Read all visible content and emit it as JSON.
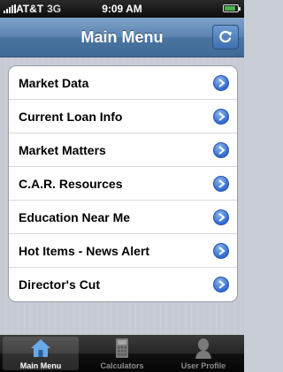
{
  "status_bar": {
    "carrier": "AT&T",
    "network": "3G",
    "time": "9:09 AM"
  },
  "nav_bar": {
    "title": "Main Menu",
    "right_button_icon": "refresh-icon"
  },
  "menu": {
    "items": [
      {
        "label": "Market Data"
      },
      {
        "label": "Current Loan Info"
      },
      {
        "label": "Market Matters"
      },
      {
        "label": "C.A.R. Resources"
      },
      {
        "label": "Education Near Me"
      },
      {
        "label": "Hot Items - News Alert"
      },
      {
        "label": "Director's Cut"
      }
    ]
  },
  "tab_bar": {
    "tabs": [
      {
        "label": "Main Menu",
        "icon": "home-icon",
        "selected": true
      },
      {
        "label": "Calculators",
        "icon": "calculator-icon",
        "selected": false
      },
      {
        "label": "User Profile",
        "icon": "user-profile-icon",
        "selected": false
      }
    ]
  },
  "colors": {
    "nav_bar": "#4f7aa6",
    "disclosure_button": "#2f6bd2",
    "tab_bar": "#1a1a1a",
    "tab_selected_icon": "#6aa9e8"
  }
}
